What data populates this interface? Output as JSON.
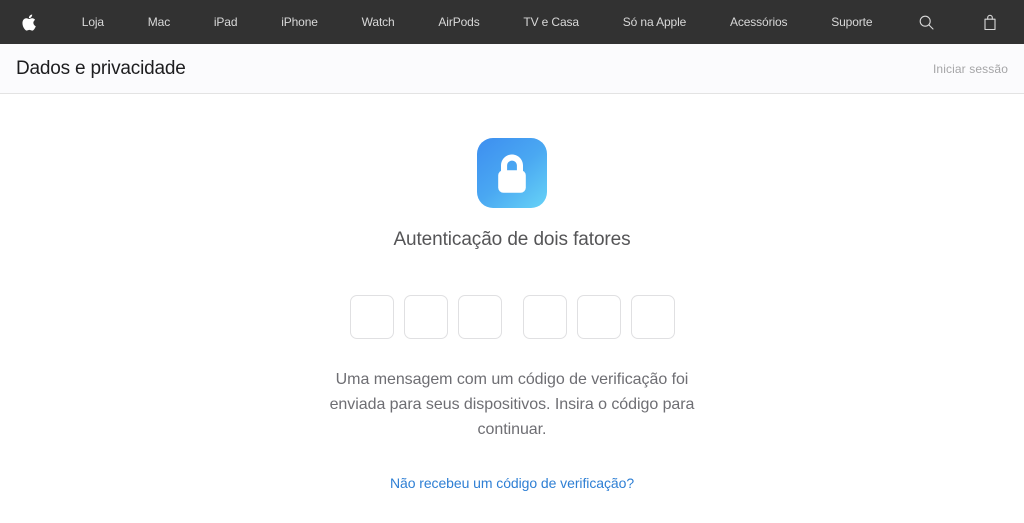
{
  "global_nav": {
    "apple_logo": "apple-logo",
    "items": [
      {
        "label": "Loja"
      },
      {
        "label": "Mac"
      },
      {
        "label": "iPad"
      },
      {
        "label": "iPhone"
      },
      {
        "label": "Watch"
      },
      {
        "label": "AirPods"
      },
      {
        "label": "TV e Casa"
      },
      {
        "label": "Só na Apple"
      },
      {
        "label": "Acessórios"
      },
      {
        "label": "Suporte"
      }
    ],
    "search_icon": "search-icon",
    "bag_icon": "shopping-bag-icon",
    "background_color": "#323232",
    "text_color": "#d8d8d8"
  },
  "sub_header": {
    "title": "Dados e privacidade",
    "signin_label": "Iniciar sessão",
    "background_color": "#fbfbfd"
  },
  "main": {
    "icon": {
      "name": "lock-app-icon",
      "gradient_start": "#3d8ef0",
      "gradient_end": "#60c8f5"
    },
    "title": "Autenticação de dois fatores",
    "code_fields": {
      "count": 6,
      "group_sizes": [
        3,
        3
      ],
      "values": [
        "",
        "",
        "",
        "",
        "",
        ""
      ],
      "placeholder": "",
      "maxlength": "1"
    },
    "instructions": "Uma mensagem com um código de verificação foi enviada para seus dispositivos. Insira o código para continuar.",
    "resend_link": "Não recebeu um código de verificação?",
    "link_color": "#2e7fd4"
  }
}
